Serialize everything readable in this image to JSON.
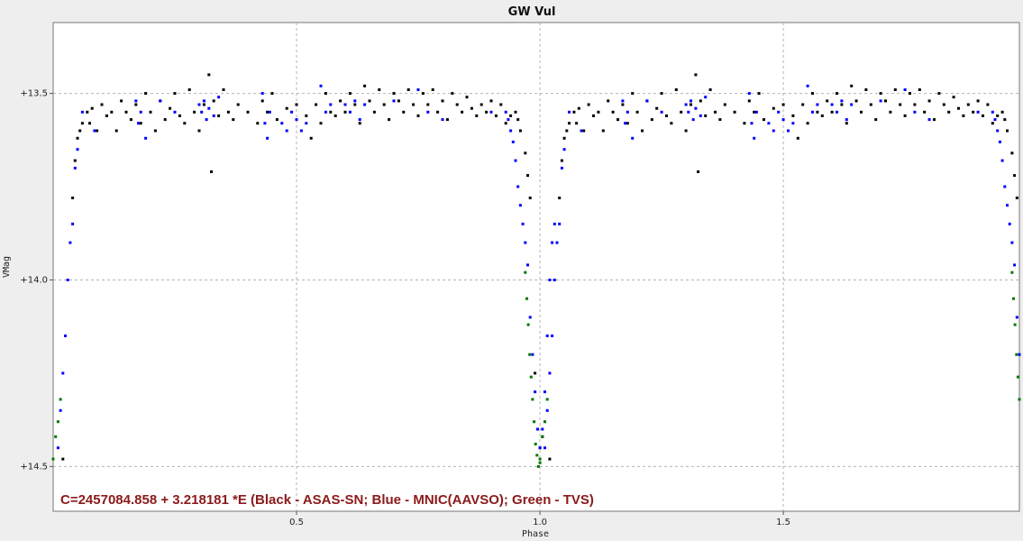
{
  "chart_data": {
    "type": "scatter",
    "title": "GW Vul",
    "xlabel": "Phase",
    "ylabel": "VMag",
    "xlim": [
      0.0,
      1.985
    ],
    "ylim": [
      14.62,
      13.31
    ],
    "y_inverted": true,
    "x_ticks": [
      "0.5",
      "1.0",
      "1.5"
    ],
    "x_tick_values": [
      0.5,
      1.0,
      1.5
    ],
    "y_ticks": [
      "+13.5",
      "+14.0",
      "+14.5"
    ],
    "y_tick_values": [
      13.5,
      14.0,
      14.5
    ],
    "grid": true,
    "annotation": "C=2457084.858 + 3.218181 *E (Black - ASAS-SN; Blue - MNIC(AAVSO); Green - TVS)",
    "annotation_color": "#8b1a1a",
    "plot_background": "#ffffff",
    "page_background": "#eeeeee",
    "phase_period_shift": 1.0,
    "series": [
      {
        "name": "Black - ASAS-SN",
        "color": "#000000",
        "points": [
          [
            0.04,
            13.78
          ],
          [
            0.045,
            13.68
          ],
          [
            0.05,
            13.62
          ],
          [
            0.055,
            13.6
          ],
          [
            0.06,
            13.58
          ],
          [
            0.07,
            13.55
          ],
          [
            0.075,
            13.58
          ],
          [
            0.08,
            13.54
          ],
          [
            0.09,
            13.6
          ],
          [
            0.1,
            13.53
          ],
          [
            0.11,
            13.56
          ],
          [
            0.12,
            13.55
          ],
          [
            0.13,
            13.6
          ],
          [
            0.14,
            13.52
          ],
          [
            0.15,
            13.55
          ],
          [
            0.16,
            13.57
          ],
          [
            0.17,
            13.53
          ],
          [
            0.18,
            13.58
          ],
          [
            0.19,
            13.5
          ],
          [
            0.2,
            13.55
          ],
          [
            0.21,
            13.6
          ],
          [
            0.22,
            13.52
          ],
          [
            0.23,
            13.57
          ],
          [
            0.24,
            13.54
          ],
          [
            0.25,
            13.5
          ],
          [
            0.26,
            13.56
          ],
          [
            0.27,
            13.58
          ],
          [
            0.28,
            13.49
          ],
          [
            0.29,
            13.55
          ],
          [
            0.3,
            13.6
          ],
          [
            0.31,
            13.53
          ],
          [
            0.32,
            13.45
          ],
          [
            0.325,
            13.71
          ],
          [
            0.33,
            13.52
          ],
          [
            0.34,
            13.56
          ],
          [
            0.35,
            13.49
          ],
          [
            0.36,
            13.55
          ],
          [
            0.37,
            13.57
          ],
          [
            0.38,
            13.53
          ],
          [
            0.4,
            13.55
          ],
          [
            0.42,
            13.58
          ],
          [
            0.43,
            13.52
          ],
          [
            0.44,
            13.55
          ],
          [
            0.45,
            13.5
          ],
          [
            0.46,
            13.57
          ],
          [
            0.48,
            13.54
          ],
          [
            0.5,
            13.53
          ],
          [
            0.52,
            13.56
          ],
          [
            0.53,
            13.62
          ],
          [
            0.54,
            13.53
          ],
          [
            0.55,
            13.58
          ],
          [
            0.56,
            13.5
          ],
          [
            0.57,
            13.55
          ],
          [
            0.58,
            13.56
          ],
          [
            0.59,
            13.52
          ],
          [
            0.6,
            13.55
          ],
          [
            0.61,
            13.5
          ],
          [
            0.62,
            13.53
          ],
          [
            0.63,
            13.58
          ],
          [
            0.64,
            13.48
          ],
          [
            0.65,
            13.52
          ],
          [
            0.66,
            13.55
          ],
          [
            0.67,
            13.49
          ],
          [
            0.68,
            13.53
          ],
          [
            0.69,
            13.57
          ],
          [
            0.7,
            13.5
          ],
          [
            0.71,
            13.52
          ],
          [
            0.72,
            13.55
          ],
          [
            0.73,
            13.49
          ],
          [
            0.74,
            13.53
          ],
          [
            0.75,
            13.56
          ],
          [
            0.76,
            13.5
          ],
          [
            0.77,
            13.53
          ],
          [
            0.78,
            13.49
          ],
          [
            0.79,
            13.55
          ],
          [
            0.8,
            13.52
          ],
          [
            0.81,
            13.57
          ],
          [
            0.82,
            13.5
          ],
          [
            0.83,
            13.53
          ],
          [
            0.84,
            13.55
          ],
          [
            0.85,
            13.51
          ],
          [
            0.86,
            13.54
          ],
          [
            0.87,
            13.56
          ],
          [
            0.88,
            13.53
          ],
          [
            0.89,
            13.55
          ],
          [
            0.9,
            13.52
          ],
          [
            0.91,
            13.56
          ],
          [
            0.92,
            13.53
          ],
          [
            0.93,
            13.58
          ],
          [
            0.94,
            13.56
          ],
          [
            0.95,
            13.55
          ],
          [
            0.955,
            13.57
          ],
          [
            0.96,
            13.6
          ],
          [
            0.97,
            13.66
          ],
          [
            0.975,
            13.72
          ],
          [
            0.98,
            13.78
          ],
          [
            0.99,
            14.25
          ],
          [
            0.995,
            14.4
          ],
          [
            1.0,
            14.45
          ],
          [
            1.005,
            14.42
          ],
          [
            0.02,
            14.48
          ]
        ]
      },
      {
        "name": "Blue - MNIC(AAVSO)",
        "color": "#0000ff",
        "points": [
          [
            0.01,
            14.45
          ],
          [
            0.015,
            14.35
          ],
          [
            0.02,
            14.25
          ],
          [
            0.025,
            14.15
          ],
          [
            0.03,
            14.0
          ],
          [
            0.035,
            13.9
          ],
          [
            0.04,
            13.85
          ],
          [
            0.045,
            13.7
          ],
          [
            0.05,
            13.65
          ],
          [
            0.06,
            13.55
          ],
          [
            0.085,
            13.6
          ],
          [
            0.17,
            13.52
          ],
          [
            0.175,
            13.58
          ],
          [
            0.18,
            13.55
          ],
          [
            0.19,
            13.62
          ],
          [
            0.22,
            13.52
          ],
          [
            0.25,
            13.55
          ],
          [
            0.3,
            13.53
          ],
          [
            0.305,
            13.55
          ],
          [
            0.31,
            13.52
          ],
          [
            0.315,
            13.57
          ],
          [
            0.32,
            13.54
          ],
          [
            0.33,
            13.56
          ],
          [
            0.34,
            13.51
          ],
          [
            0.43,
            13.5
          ],
          [
            0.435,
            13.58
          ],
          [
            0.44,
            13.62
          ],
          [
            0.445,
            13.55
          ],
          [
            0.47,
            13.58
          ],
          [
            0.48,
            13.6
          ],
          [
            0.49,
            13.55
          ],
          [
            0.5,
            13.57
          ],
          [
            0.51,
            13.6
          ],
          [
            0.52,
            13.58
          ],
          [
            0.55,
            13.48
          ],
          [
            0.56,
            13.55
          ],
          [
            0.57,
            13.53
          ],
          [
            0.6,
            13.53
          ],
          [
            0.61,
            13.55
          ],
          [
            0.62,
            13.52
          ],
          [
            0.63,
            13.57
          ],
          [
            0.64,
            13.53
          ],
          [
            0.7,
            13.52
          ],
          [
            0.75,
            13.49
          ],
          [
            0.77,
            13.55
          ],
          [
            0.8,
            13.57
          ],
          [
            0.9,
            13.55
          ],
          [
            0.93,
            13.55
          ],
          [
            0.935,
            13.57
          ],
          [
            0.94,
            13.6
          ],
          [
            0.945,
            13.63
          ],
          [
            0.95,
            13.68
          ],
          [
            0.955,
            13.75
          ],
          [
            0.96,
            13.8
          ],
          [
            0.965,
            13.85
          ],
          [
            0.97,
            13.9
          ],
          [
            0.975,
            13.96
          ],
          [
            0.98,
            14.1
          ],
          [
            0.985,
            14.2
          ],
          [
            0.99,
            14.3
          ],
          [
            0.995,
            14.4
          ],
          [
            1.0,
            14.45
          ],
          [
            1.005,
            14.4
          ],
          [
            1.01,
            14.3
          ],
          [
            1.015,
            14.15
          ],
          [
            1.02,
            14.0
          ],
          [
            1.025,
            13.9
          ],
          [
            1.03,
            13.85
          ]
        ]
      },
      {
        "name": "Green - TVS",
        "color": "#007700",
        "points": [
          [
            0.0,
            14.48
          ],
          [
            0.005,
            14.42
          ],
          [
            0.01,
            14.38
          ],
          [
            0.015,
            14.32
          ],
          [
            0.97,
            13.98
          ],
          [
            0.973,
            14.05
          ],
          [
            0.976,
            14.12
          ],
          [
            0.979,
            14.2
          ],
          [
            0.982,
            14.26
          ],
          [
            0.985,
            14.32
          ],
          [
            0.988,
            14.38
          ],
          [
            0.991,
            14.44
          ],
          [
            0.994,
            14.47
          ],
          [
            0.997,
            14.5
          ],
          [
            1.0,
            14.49
          ]
        ]
      }
    ]
  }
}
